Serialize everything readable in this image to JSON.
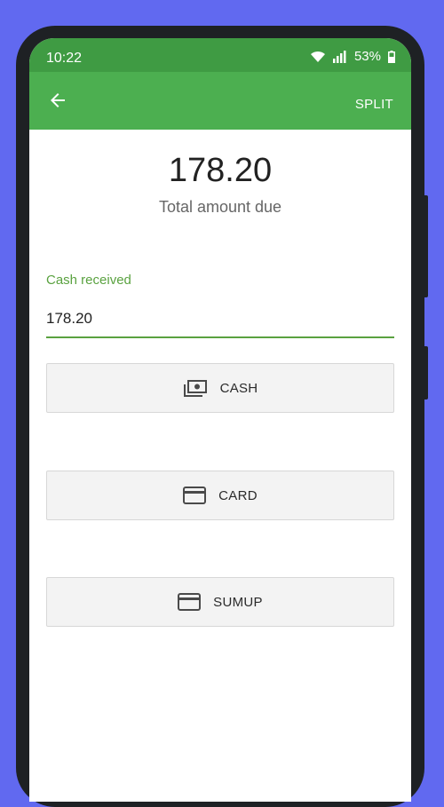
{
  "status_bar": {
    "time": "10:22",
    "battery": "53%",
    "icons": [
      "wifi-icon",
      "signal-icon",
      "battery-icon"
    ]
  },
  "app_bar": {
    "back_icon": "arrow-back-icon",
    "split_label": "SPLIT",
    "color": "#4caf50"
  },
  "summary": {
    "total_amount": "178.20",
    "total_label": "Total amount due"
  },
  "cash_field": {
    "label": "Cash received",
    "value": "178.20",
    "accent": "#5aa240"
  },
  "payment_buttons": [
    {
      "label": "CASH",
      "icon": "cash-icon"
    },
    {
      "label": "CARD",
      "icon": "card-icon"
    },
    {
      "label": "SUMUP",
      "icon": "card-icon"
    }
  ]
}
